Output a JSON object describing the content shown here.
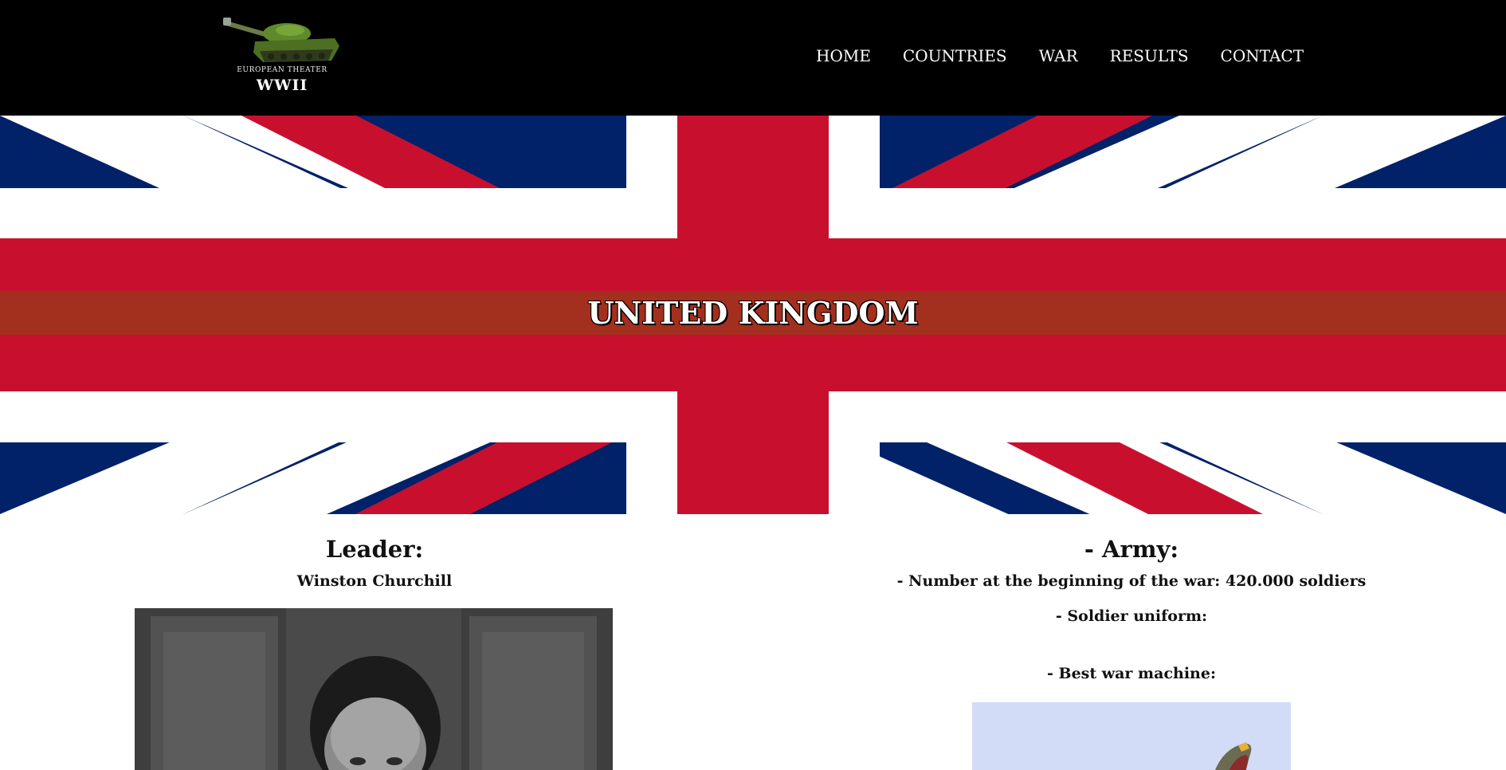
{
  "header": {
    "logo_subtitle": "EUROPEAN THEATER",
    "logo_title": "WWII",
    "logo_icon": "tank-icon",
    "nav": [
      {
        "label": "HOME"
      },
      {
        "label": "COUNTRIES"
      },
      {
        "label": "WAR"
      },
      {
        "label": "RESULTS"
      },
      {
        "label": "CONTACT"
      }
    ]
  },
  "hero": {
    "title": "UNITED KINGDOM",
    "flag": "union-jack-flag",
    "colors": {
      "blue": "#012169",
      "red": "#c8102e",
      "white": "#ffffff",
      "band": "#a3301e"
    }
  },
  "leader": {
    "heading": "Leader:",
    "name": "Winston Churchill",
    "photo": "winston-churchill-photo"
  },
  "army": {
    "heading": "- Army:",
    "soldiers": "- Number at the beginning of the war: 420.000 soldiers",
    "uniform": "- Soldier uniform:",
    "machine": "- Best war machine:",
    "machine_image": "spitfire-plane-photo"
  }
}
